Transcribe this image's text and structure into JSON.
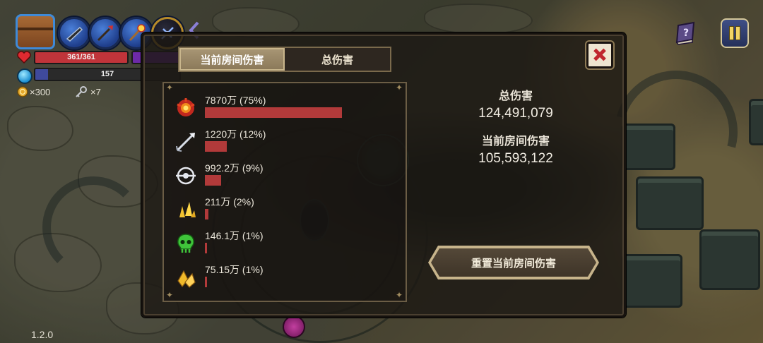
{
  "hud": {
    "hp_text": "361/361",
    "hp_fraction": 1.0,
    "mana_text": "157",
    "mana_fraction": 0.09,
    "coins": "×300",
    "keys": "×7",
    "version": "1.2.0",
    "icons": [
      "chest-icon",
      "shotgun-icon",
      "spear-icon",
      "staff-icon",
      "crossbow-icon"
    ]
  },
  "tabs": [
    {
      "label": "当前房间伤害",
      "active": true
    },
    {
      "label": "总伤害",
      "active": false
    }
  ],
  "damage_rows": [
    {
      "icon": "fire-burst-icon",
      "label": "7870万 (75%)",
      "share": 0.75
    },
    {
      "icon": "arrow-icon",
      "label": "1220万 (12%)",
      "share": 0.12
    },
    {
      "icon": "target-eye-icon",
      "label": "992.2万 (9%)",
      "share": 0.09
    },
    {
      "icon": "yellow-shards-icon",
      "label": "211万 (2%)",
      "share": 0.02
    },
    {
      "icon": "green-skull-icon",
      "label": "146.1万 (1%)",
      "share": 0.01
    },
    {
      "icon": "gold-crystals-icon",
      "label": "75.15万 (1%)",
      "share": 0.01
    }
  ],
  "summary": {
    "total_label": "总伤害",
    "total_value": "124,491,079",
    "room_label": "当前房间伤害",
    "room_value": "105,593,122"
  },
  "reset_button": "重置当前房间伤害",
  "colors": {
    "damage_bar": "#b23a3a",
    "hp_bar": "#c0343a",
    "mana_bar": "#3f4a9c"
  }
}
